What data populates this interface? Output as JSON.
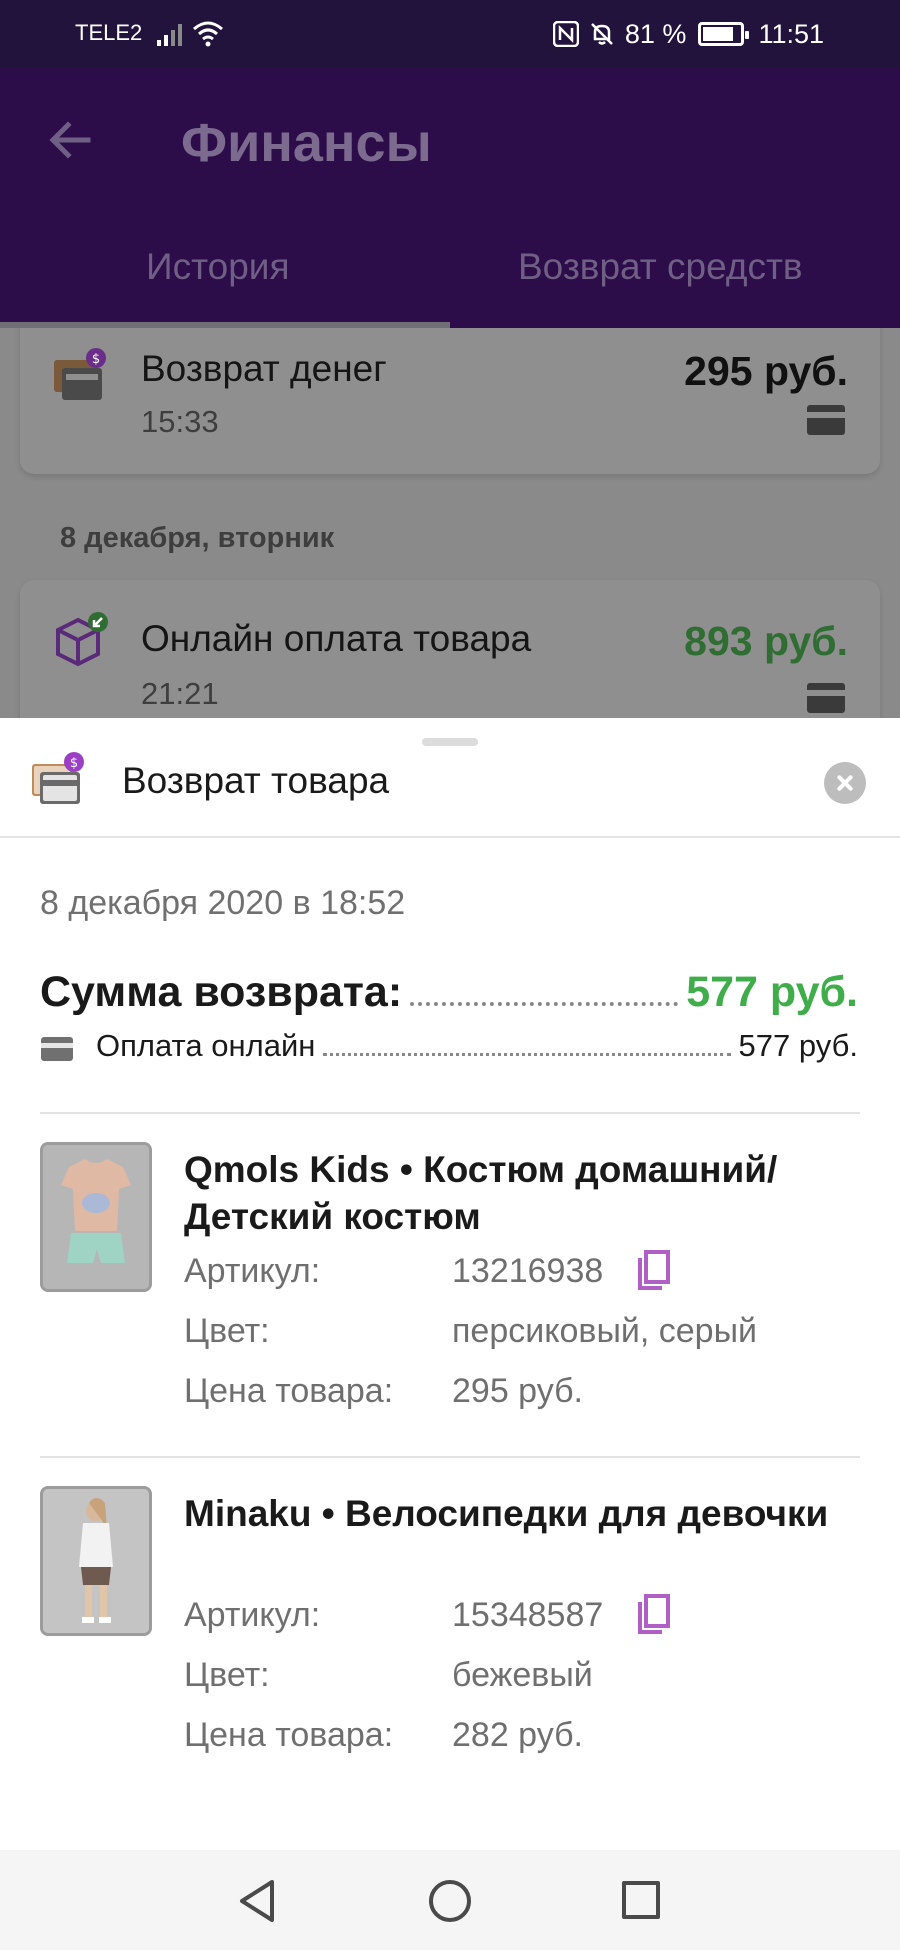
{
  "status_bar": {
    "carrier": "TELE2",
    "battery_percent": "81 %",
    "time": "11:51",
    "battery_level": 0.81
  },
  "app_bar": {
    "title": "Финансы",
    "tabs": [
      {
        "label": "История",
        "active": true
      },
      {
        "label": "Возврат средств",
        "active": false
      }
    ]
  },
  "history": {
    "items": [
      {
        "title": "Возврат денег",
        "time": "15:33",
        "amount": "295 руб.",
        "amount_color": "#111111",
        "icon": "refund-wallet-icon"
      },
      {
        "title": "Онлайн оплата товара",
        "time": "21:21",
        "amount": "893 руб.",
        "amount_color": "#2f6d33",
        "icon": "package-payment-icon"
      }
    ],
    "date_header": "8 декабря, вторник"
  },
  "sheet": {
    "title": "Возврат товара",
    "date": "8 декабря 2020 в 18:52",
    "sum_label": "Сумма возврата:",
    "sum_value": "577 руб.",
    "payment_label": "Оплата онлайн",
    "payment_value": "577 руб.",
    "products": [
      {
        "name": "Qmols Kids • Костюм домашний/ Детский костюм",
        "article_label": "Артикул:",
        "article": "13216938",
        "color_label": "Цвет:",
        "color": "персиковый, серый",
        "price_label": "Цена товара:",
        "price": "295 руб."
      },
      {
        "name": "Minaku • Велосипедки для девочки",
        "article_label": "Артикул:",
        "article": "15348587",
        "color_label": "Цвет:",
        "color": "бежевый",
        "price_label": "Цена товара:",
        "price": "282 руб."
      }
    ]
  },
  "colors": {
    "accent_purple": "#2c0d4a",
    "copy_icon": "#b05fc4",
    "green": "#3fae4a"
  }
}
